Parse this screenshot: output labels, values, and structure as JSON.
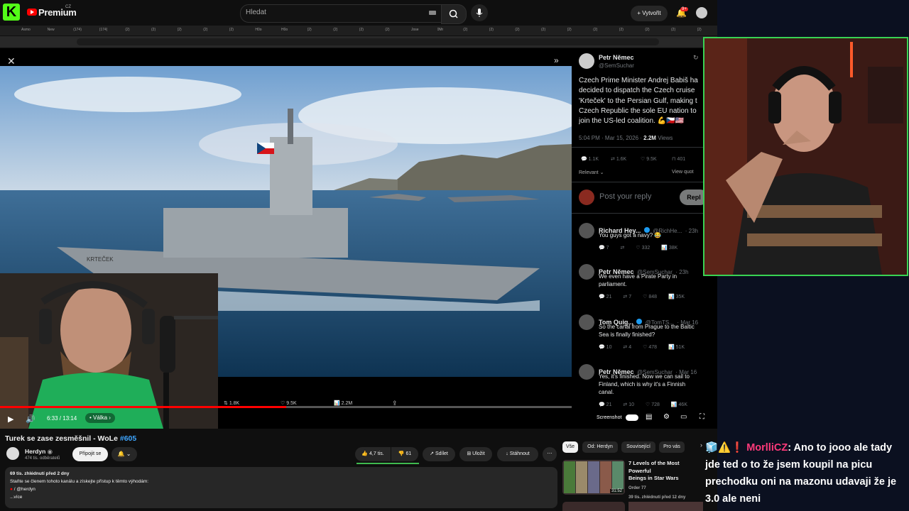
{
  "topbar": {
    "kick_logo": "K",
    "yt_brand": "Premium",
    "yt_country": "CZ",
    "search_placeholder": "Hledat",
    "create_label": "Vytvořit",
    "notif_count": "9+"
  },
  "tabs": [
    "Asmo",
    "New",
    "(174)",
    "(174)",
    "(2)",
    "(2)",
    "(2)",
    "(2)",
    "(2)",
    "H0o",
    "H0o",
    "(2)",
    "(2)",
    "(2)",
    "(2)",
    "Jose",
    "0Mr",
    "(2)",
    "(2)",
    "(2)",
    "(2)",
    "(2)",
    "(2)",
    "(2)",
    "(2)",
    "(2)",
    "(2)"
  ],
  "tweet": {
    "author": "Petr Němec",
    "handle": "@SemSuchar",
    "lines": [
      "Czech Prime Minister Andrej Babiš ha",
      "decided to dispatch the Czech cruise",
      "'Krteček' to the Persian Gulf, making t",
      "Czech Republic the sole EU nation to",
      "join the US-led coalition. 💪🇨🇿🇺🇸"
    ],
    "time": "5:04 PM · Mar 15, 2026 ·",
    "views_count": "2.2M",
    "views_label": "Views",
    "stats": {
      "replies": "1.1K",
      "reposts": "1.6K",
      "likes": "9.5K",
      "bookmarks": "401"
    },
    "relevant": "Relevant",
    "view_quotes": "View quot",
    "reply_placeholder": "Post your reply",
    "reply_button": "Repl",
    "replies": [
      {
        "name": "Richard Hey...",
        "handle": "@RichHe...",
        "time": "· 23h",
        "lines": [
          "You guys got a navy? 😂"
        ],
        "stats": [
          "7",
          "",
          "332",
          "38K"
        ]
      },
      {
        "name": "Petr Němec",
        "handle": "@SemSuchar",
        "time": "· 23h",
        "lines": [
          "We even have a Pirate Party in",
          "parliament."
        ],
        "stats": [
          "21",
          "7",
          "848",
          "35K"
        ]
      },
      {
        "name": "Tom Quig...",
        "handle": "@TomTS...",
        "time": "· Mar 16",
        "lines": [
          "So the canal from Prague to the Baltic",
          "Sea is finally finished?"
        ],
        "stats": [
          "10",
          "4",
          "478",
          "51K"
        ]
      },
      {
        "name": "Petr Němec",
        "handle": "@SemSuchar",
        "time": "· Mar 16",
        "lines": [
          "Yes, it's finished. Now we can sail to",
          "Finland, which is why it's a Finnish",
          "canal."
        ],
        "stats": [
          "21",
          "10",
          "728",
          "46K"
        ]
      }
    ]
  },
  "player": {
    "time": "6:33 / 13:14",
    "chapter": "Válka",
    "overlay_stats": [
      "1.8K",
      "9.5K",
      "2.2M"
    ],
    "screenshot_label": "Screenshot",
    "progress_fraction": 0.5
  },
  "video": {
    "title": "Turek se zase zesměšnil - WoLe",
    "hashtag": "#605",
    "ship_name": "KRTEČEK"
  },
  "channel": {
    "name": "Herdyn",
    "subscribers": "474 tis. odběratelů",
    "join_label": "Připojit se"
  },
  "actions": {
    "likes": "4,7 tis.",
    "dislikes": "61",
    "share": "Sdílet",
    "save": "Uložit",
    "download": "Stáhnout"
  },
  "description": {
    "stats": "69 tis. zhlédnutí  před 2 dny",
    "line1": "Staňte se členem tohoto kanálu a získejte přístup k těmto výhodám:",
    "line2": "/ @herdyn",
    "more": "...více"
  },
  "chips": [
    "Vše",
    "Od: Herdyn",
    "Související",
    "Pro vás"
  ],
  "recommendation": {
    "title_lines": [
      "7 Levels of the Most Powerful",
      "Beings in Star Wars"
    ],
    "channel": "Order 77",
    "meta": "39 tis. zhlédnutí  před 12 dny",
    "duration": "31:52"
  },
  "chat": {
    "user": "MorlliCZ",
    "text": ": Ano to jooo ale tady jde ted o to že jsem koupil na picu prechodku oni na mazonu udavaji že je 3.0 ale neni"
  },
  "colors": {
    "youtube_red": "#ff0000",
    "kick_green": "#53fc18",
    "cam_border": "#39d353",
    "link_blue": "#3ea6ff",
    "chat_user": "#ff3a7a"
  }
}
